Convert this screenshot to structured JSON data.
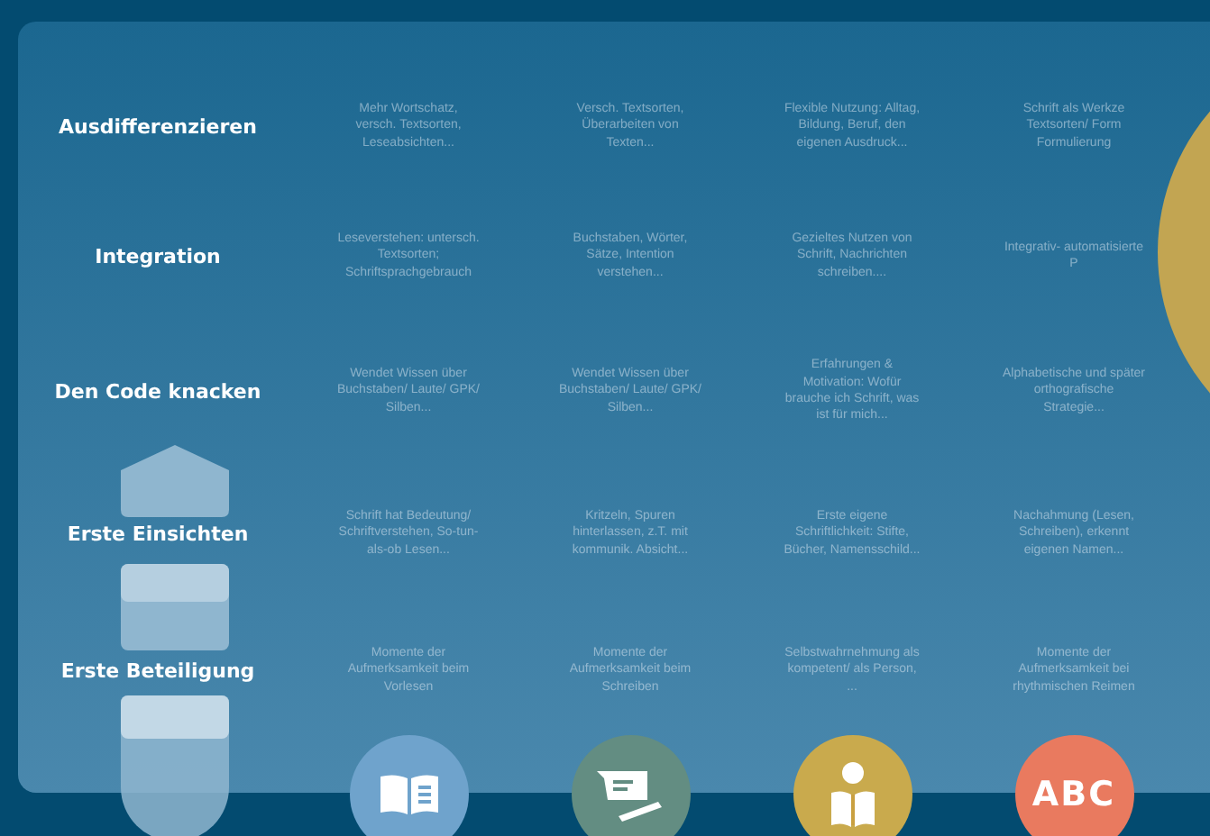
{
  "rows": [
    {
      "label": "Ausdifferenzieren",
      "cells": [
        "Mehr Wortschatz, versch. Textsorten, Leseabsichten...",
        "Versch. Textsorten, Überarbeiten von Texten...",
        "Flexible Nutzung: Alltag, Bildung, Beruf, den eigenen Ausdruck...",
        "Schrift als Werkze Textsorten/ Form Formulierung"
      ]
    },
    {
      "label": "Integration",
      "cells": [
        "Leseverstehen: untersch. Textsorten; Schriftsprachgebrauch",
        "Buchstaben, Wörter, Sätze, Intention verstehen...",
        "Gezieltes Nutzen von Schrift, Nachrichten schreiben....",
        "Integrativ- automatisierte P"
      ]
    },
    {
      "label": "Den Code knacken",
      "cells": [
        "Wendet Wissen über Buchstaben/ Laute/ GPK/ Silben...",
        "Wendet Wissen über Buchstaben/ Laute/ GPK/ Silben...",
        "Erfahrungen & Motivation: Wofür  brauche ich Schrift, was ist für mich...",
        "Alphabetische und später orthografische Strategie..."
      ]
    },
    {
      "label": "Erste Einsichten",
      "cells": [
        "Schrift hat Bedeutung/ Schriftverstehen, So-tun-als-ob Lesen...",
        "Kritzeln, Spuren hinterlassen, z.T. mit kommunik. Absicht...",
        "Erste eigene Schriftlichkeit: Stifte, Bücher, Namensschild...",
        "Nachahmung (Lesen, Schreiben), erkennt eigenen Namen..."
      ]
    },
    {
      "label": "Erste Beteiligung",
      "cells": [
        "Momente der Aufmerksamkeit beim  Vorlesen",
        "Momente der Aufmerksamkeit beim Schreiben",
        "Selbstwahrnehmung als kompetent/ als Person, ...",
        "Momente der Aufmerksamkeit bei rhythmischen Reimen"
      ]
    }
  ],
  "icons": [
    {
      "kind": "book",
      "color": "#6fa3cc"
    },
    {
      "kind": "writing",
      "color": "#638d82"
    },
    {
      "kind": "reader",
      "color": "#c9aa4d"
    },
    {
      "kind": "letters",
      "color": "#e97a5f",
      "text": "ABC"
    }
  ]
}
